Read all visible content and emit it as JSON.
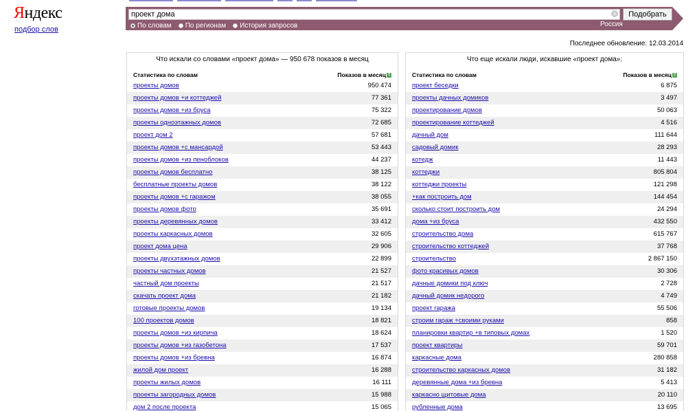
{
  "header": {
    "logo_first": "Я",
    "logo_rest": "ндекс",
    "subtitle": "подбор слов"
  },
  "search": {
    "query": "проект дома",
    "button_label": "Подобрать",
    "modes": [
      {
        "label": "По словам",
        "selected": true
      },
      {
        "label": "По регионам",
        "selected": false
      },
      {
        "label": "История запросов",
        "selected": false
      }
    ],
    "region": "Россия"
  },
  "updated": "Последнее обновление: 12.03.2014",
  "colors": {
    "bar": "#8e5a70",
    "link": "#1a0dab",
    "stripe": "#efefef"
  },
  "left_panel": {
    "title": "Что искали со словами «проект дома» — 950 678 показов в месяц",
    "col_phrase": "Статистика по словам",
    "col_count": "Показов в месяц",
    "rows": [
      {
        "phrase": "проекты домов",
        "count": "950 474"
      },
      {
        "phrase": "проекты домов +и коттеджей",
        "count": "77 361"
      },
      {
        "phrase": "проекты домов +из бруса",
        "count": "75 322"
      },
      {
        "phrase": "проекты одноэтажных домов",
        "count": "72 685"
      },
      {
        "phrase": "проект дом 2",
        "count": "57 681"
      },
      {
        "phrase": "проекты домов +с мансардой",
        "count": "53 443"
      },
      {
        "phrase": "проекты домов +из пеноблоков",
        "count": "44 237"
      },
      {
        "phrase": "проекты домов бесплатно",
        "count": "38 125"
      },
      {
        "phrase": "бесплатные проекты домов",
        "count": "38 122"
      },
      {
        "phrase": "проекты домов +с гаражом",
        "count": "38 055"
      },
      {
        "phrase": "проекты домов фото",
        "count": "35 691"
      },
      {
        "phrase": "проекты деревянных домов",
        "count": "33 412"
      },
      {
        "phrase": "проекты каркасных домов",
        "count": "32 605"
      },
      {
        "phrase": "проект дома цена",
        "count": "29 906"
      },
      {
        "phrase": "проекты двухэтажных домов",
        "count": "22 899"
      },
      {
        "phrase": "проекты частных домов",
        "count": "21 527"
      },
      {
        "phrase": "частный дом проекты",
        "count": "21 517"
      },
      {
        "phrase": "скачать проект дома",
        "count": "21 182"
      },
      {
        "phrase": "готовые проекты домов",
        "count": "19 134"
      },
      {
        "phrase": "100 проектов домов",
        "count": "18 821"
      },
      {
        "phrase": "проекты домов +из кирпича",
        "count": "18 624"
      },
      {
        "phrase": "проекты домов +из газобетона",
        "count": "17 537"
      },
      {
        "phrase": "проекты домов +из бревна",
        "count": "16 874"
      },
      {
        "phrase": "жилой дом проект",
        "count": "16 288"
      },
      {
        "phrase": "проекты жилых домов",
        "count": "16 111"
      },
      {
        "phrase": "проекты загородных домов",
        "count": "15 988"
      },
      {
        "phrase": "дом 2 после проекта",
        "count": "15 065"
      }
    ]
  },
  "right_panel": {
    "title": "Что еще искали люди, искавшие «проект дома»:",
    "col_phrase": "Статистика по словам",
    "col_count": "Показов в месяц",
    "rows": [
      {
        "phrase": "проект беседки",
        "count": "6 875"
      },
      {
        "phrase": "проекты дачных домиков",
        "count": "3 497"
      },
      {
        "phrase": "проектирование домов",
        "count": "50 063"
      },
      {
        "phrase": "проектирование коттеджей",
        "count": "4 516"
      },
      {
        "phrase": "дачный дом",
        "count": "111 644"
      },
      {
        "phrase": "садовый домик",
        "count": "28 293"
      },
      {
        "phrase": "котедж",
        "count": "11 443"
      },
      {
        "phrase": "коттеджи",
        "count": "805 804"
      },
      {
        "phrase": "коттеджи проекты",
        "count": "121 298"
      },
      {
        "phrase": "+как построить дом",
        "count": "144 454"
      },
      {
        "phrase": "сколько стоит построить дом",
        "count": "24 294"
      },
      {
        "phrase": "дома +из бруса",
        "count": "432 550"
      },
      {
        "phrase": "строительство дома",
        "count": "615 767"
      },
      {
        "phrase": "строительство коттеджей",
        "count": "37 768"
      },
      {
        "phrase": "строительство",
        "count": "2 867 150"
      },
      {
        "phrase": "фото красивых домов",
        "count": "30 306"
      },
      {
        "phrase": "дачные домики под ключ",
        "count": "2 728"
      },
      {
        "phrase": "дачный домик недорого",
        "count": "4 749"
      },
      {
        "phrase": "проект гаража",
        "count": "55 506"
      },
      {
        "phrase": "строим гараж +своими руками",
        "count": "858"
      },
      {
        "phrase": "планировки квартир +в типовых домах",
        "count": "1 520"
      },
      {
        "phrase": "проект квартиры",
        "count": "59 701"
      },
      {
        "phrase": "каркасные дома",
        "count": "280 858"
      },
      {
        "phrase": "строительство каркасных домов",
        "count": "31 182"
      },
      {
        "phrase": "деревянные дома +из бревна",
        "count": "5 413"
      },
      {
        "phrase": "каркасно щитовые дома",
        "count": "20 110"
      },
      {
        "phrase": "рубленные дома",
        "count": "13 695"
      }
    ]
  }
}
